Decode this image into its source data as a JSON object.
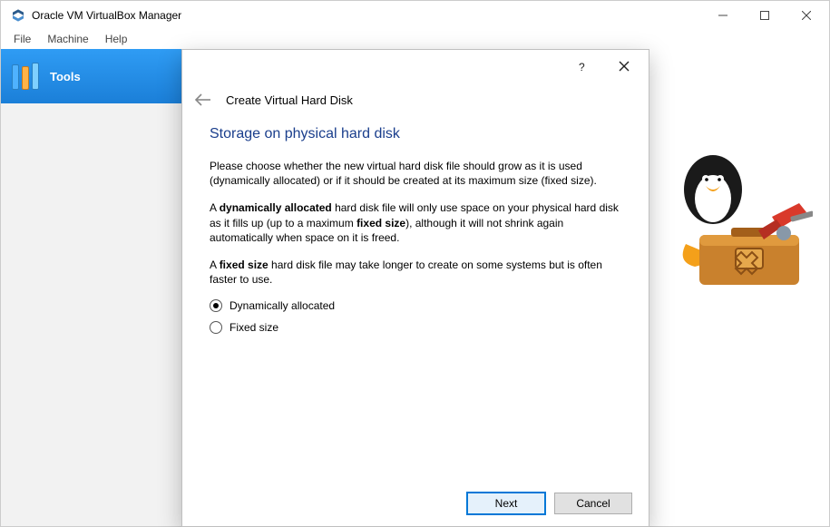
{
  "titlebar": {
    "title": "Oracle VM VirtualBox Manager"
  },
  "menu": {
    "file": "File",
    "machine": "Machine",
    "help": "Help"
  },
  "sidebar": {
    "tools_label": "Tools"
  },
  "dialog": {
    "wizard_title": "Create Virtual Hard Disk",
    "section_title": "Storage on physical hard disk",
    "para1": "Please choose whether the new virtual hard disk file should grow as it is used (dynamically allocated) or if it should be created at its maximum size (fixed size).",
    "para2_a": "A ",
    "para2_b": "dynamically allocated",
    "para2_c": " hard disk file will only use space on your physical hard disk as it fills up (up to a maximum ",
    "para2_d": "fixed size",
    "para2_e": "), although it will not shrink again automatically when space on it is freed.",
    "para3_a": "A ",
    "para3_b": "fixed size",
    "para3_c": " hard disk file may take longer to create on some systems but is often faster to use.",
    "option_dynamic": "Dynamically allocated",
    "option_fixed": "Fixed size",
    "next": "Next",
    "cancel": "Cancel"
  }
}
